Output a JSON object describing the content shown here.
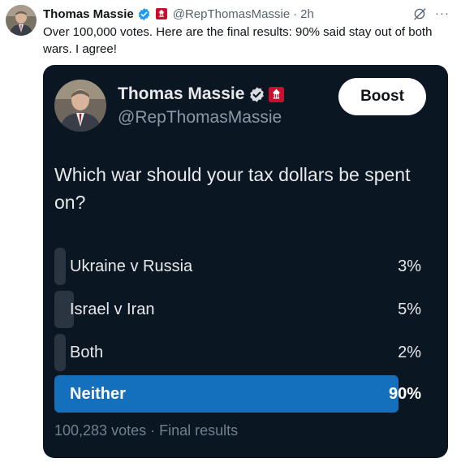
{
  "tweet": {
    "author_name": "Thomas Massie",
    "handle": "@RepThomasMassie",
    "separator": "·",
    "time": "2h",
    "text": "Over 100,000 votes. Here are the final results: 90% said stay out of both wars. I agree!",
    "more_label": "···"
  },
  "quoted": {
    "author_name": "Thomas Massie",
    "handle": "@RepThomasMassie",
    "boost_label": "Boost",
    "poll": {
      "question": "Which war should your tax dollars be spent on?",
      "options": [
        {
          "label": "Ukraine v Russia",
          "percent": "3%",
          "share": 0.03
        },
        {
          "label": "Israel v Iran",
          "percent": "5%",
          "share": 0.05
        },
        {
          "label": "Both",
          "percent": "2%",
          "share": 0.02
        },
        {
          "label": "Neither",
          "percent": "90%",
          "share": 0.9
        }
      ],
      "votes": "100,283 votes",
      "separator": "·",
      "status": "Final results"
    }
  },
  "colors": {
    "verified": "#1d9bf0",
    "affiliation": "#c8102e",
    "card_background": "#0b1623",
    "bar_default": "#2a3541",
    "bar_winner": "#1470bd"
  },
  "icons": {
    "verified": "verified-badge-icon",
    "affiliation": "congress-affiliation-icon",
    "grok": "grok-icon",
    "more": "more-icon"
  }
}
